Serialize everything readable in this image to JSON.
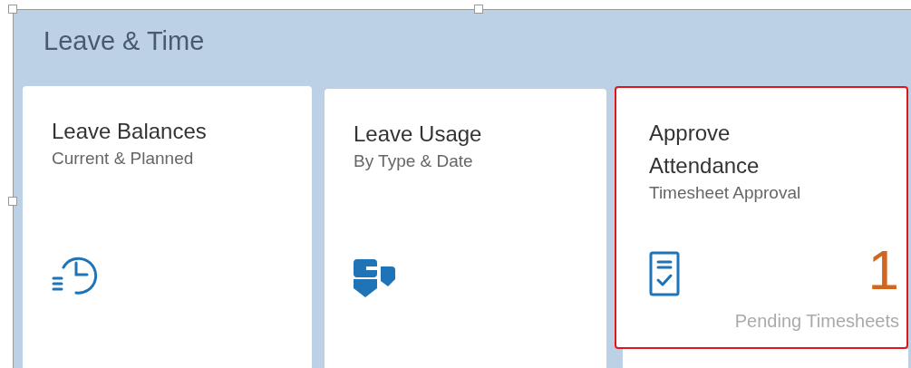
{
  "group": {
    "title": "Leave & Time"
  },
  "tiles": [
    {
      "title": "Leave Balances",
      "subtitle": "Current & Planned",
      "highlighted": false
    },
    {
      "title": "Leave Usage",
      "subtitle": "By Type & Date",
      "highlighted": false
    },
    {
      "title": "Approve Attendance",
      "subtitle": "Timesheet Approval",
      "count": "1",
      "footer": "Pending Timesheets",
      "highlighted": true
    }
  ]
}
